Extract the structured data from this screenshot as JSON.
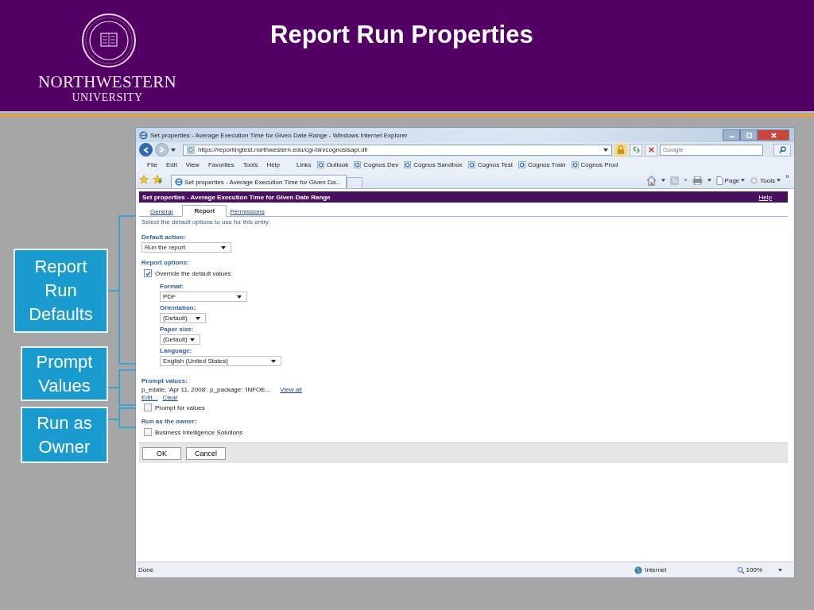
{
  "slide": {
    "title": "Report Run Properties",
    "logo_name": "NORTHWESTERN",
    "logo_subtitle": "UNIVERSITY"
  },
  "callouts": [
    {
      "label": "Report Run Defaults"
    },
    {
      "label": "Prompt Values"
    },
    {
      "label": "Run as Owner"
    }
  ],
  "browser": {
    "title": "Set properties - Average Execution Time for Given Date Range - Windows Internet Explorer",
    "address": "https://reportingtest.northwestern.edu/cgi-bin/cognosisapi.dll",
    "search_placeholder": "Google",
    "menu": [
      "File",
      "Edit",
      "View",
      "Favorites",
      "Tools",
      "Help"
    ],
    "links_label": "Links",
    "links": [
      "Outlook",
      "Cognos Dev",
      "Cognos Sandbox",
      "Cognos Test",
      "Cognos Train",
      "Cognos Prod"
    ],
    "tab": "Set properties - Average Execution Time for Given Da...",
    "page_menu": "Page",
    "tools_menu": "Tools",
    "chevron": "»"
  },
  "page": {
    "header": "Set properties - Average Execution Time for Given Date Range",
    "help": "Help",
    "tabs": [
      {
        "label": "General",
        "selected": false
      },
      {
        "label": "Report",
        "selected": true
      },
      {
        "label": "Permissions",
        "selected": false
      }
    ],
    "intro": "Select the default options to use for this entry.",
    "default_action": {
      "label": "Default action:",
      "value": "Run the report"
    },
    "report_options": {
      "label": "Report options:",
      "override": {
        "label": "Override the default values",
        "checked": true
      },
      "format": {
        "label": "Format:",
        "value": "PDF"
      },
      "orientation": {
        "label": "Orientation:",
        "value": "(Default)"
      },
      "paper_size": {
        "label": "Paper size:",
        "value": "(Default)"
      },
      "language": {
        "label": "Language:",
        "value": "English (United States)"
      }
    },
    "prompt_values": {
      "label": "Prompt values:",
      "summary": "p_edate: 'Apr 11, 2008'. p_package: 'INFOE...",
      "view_all": "View all",
      "edit": "Edit...",
      "clear": "Clear",
      "prompt": {
        "label": "Prompt for values",
        "checked": false
      }
    },
    "owner": {
      "label": "Run as the owner:",
      "option": {
        "label": "Business Intelligence Solutions",
        "checked": false
      }
    },
    "buttons": [
      "OK",
      "Cancel"
    ]
  },
  "status_bar": {
    "text": "Done",
    "zone": "Internet",
    "zoom": "100%"
  }
}
